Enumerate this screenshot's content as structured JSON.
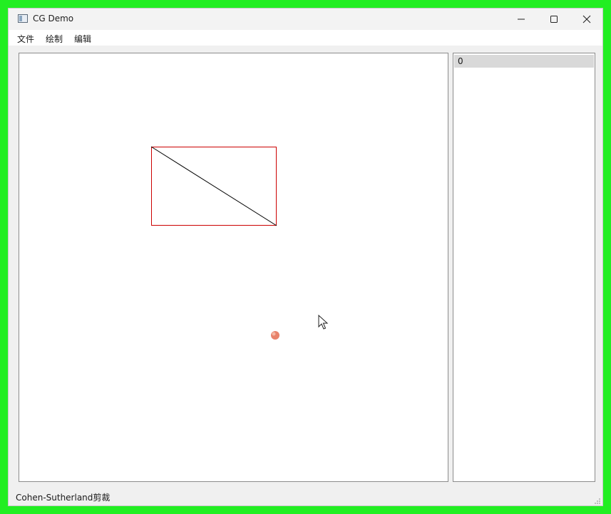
{
  "window": {
    "title": "CG Demo",
    "icons": {
      "app": "app-window-icon",
      "minimize": "minimize-icon",
      "maximize": "maximize-icon",
      "close": "close-icon"
    }
  },
  "menubar": {
    "items": [
      {
        "label": "文件"
      },
      {
        "label": "绘制"
      },
      {
        "label": "编辑"
      }
    ]
  },
  "canvas": {
    "colors": {
      "rectangle": "#cc0000",
      "line": "#000000",
      "click_marker": "#e8826a"
    },
    "icons": {
      "cursor": "mouse-pointer-icon",
      "marker": "click-marker-icon"
    }
  },
  "item_list": {
    "items": [
      {
        "label": "0"
      }
    ]
  },
  "statusbar": {
    "text": "Cohen-Sutherland剪裁"
  }
}
